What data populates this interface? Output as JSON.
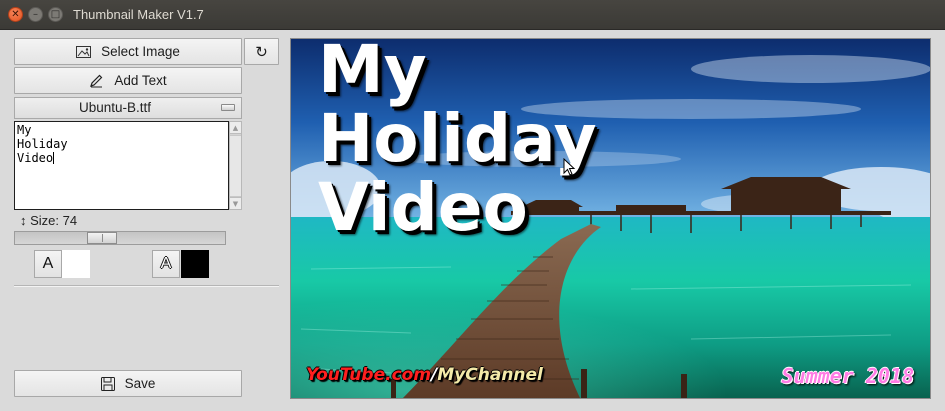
{
  "window": {
    "title": "Thumbnail Maker V1.7",
    "controls": [
      "close",
      "minimize",
      "maximize"
    ]
  },
  "toolbar": {
    "select_image_label": "Select Image",
    "select_image_icon": "image-icon",
    "refresh_icon": "refresh-icon",
    "refresh_glyph": "↻",
    "add_text_label": "Add Text",
    "add_text_icon": "pencil-icon",
    "save_label": "Save",
    "save_icon": "floppy-disk-icon"
  },
  "font": {
    "selected": "Ubuntu-B.ttf"
  },
  "text_input": {
    "lines": [
      "My",
      "Holiday",
      "Video"
    ]
  },
  "size": {
    "label": "↕ Size: 74",
    "value": 74,
    "slider_fraction": 0.4
  },
  "colors": {
    "fill_button_glyph": "A",
    "fill_color": "#ffffff",
    "outline_button_glyph": "A",
    "outline_color": "#000000"
  },
  "preview": {
    "overlay_lines": [
      "My",
      "Holiday",
      "Video"
    ],
    "watermark_red": "YouTube.com",
    "watermark_slash": "/",
    "watermark_channel": "MyChannel",
    "date_text": "Summer 2018",
    "scene": "tropical-overwater-bungalow-boardwalk"
  }
}
